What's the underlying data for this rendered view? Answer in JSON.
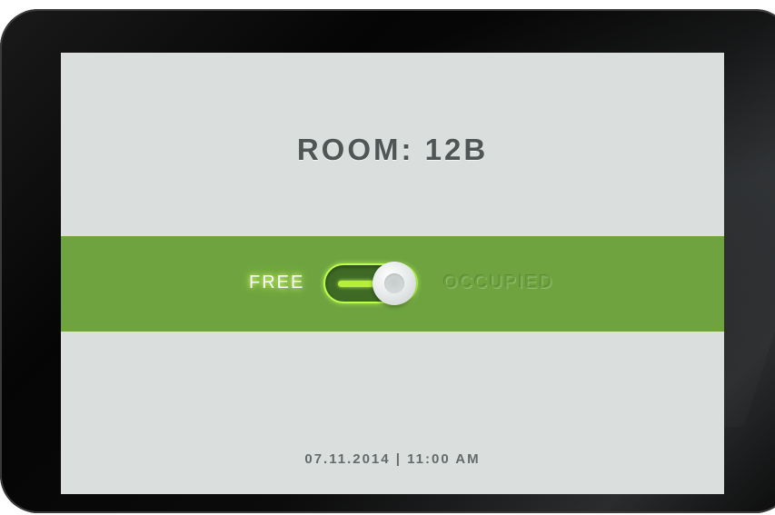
{
  "room": {
    "title": "ROOM: 12B"
  },
  "status": {
    "free_label": "FREE",
    "occupied_label": "OCCUPIED",
    "selected": "FREE",
    "band_color": "#6ea340",
    "glow_color": "#b9ff4a"
  },
  "footer": {
    "datetime": "07.11.2014 | 11:00 AM"
  },
  "colors": {
    "screen_background": "#dadfde",
    "title_text": "#505556",
    "device_bezel": "#0a0a0a"
  }
}
